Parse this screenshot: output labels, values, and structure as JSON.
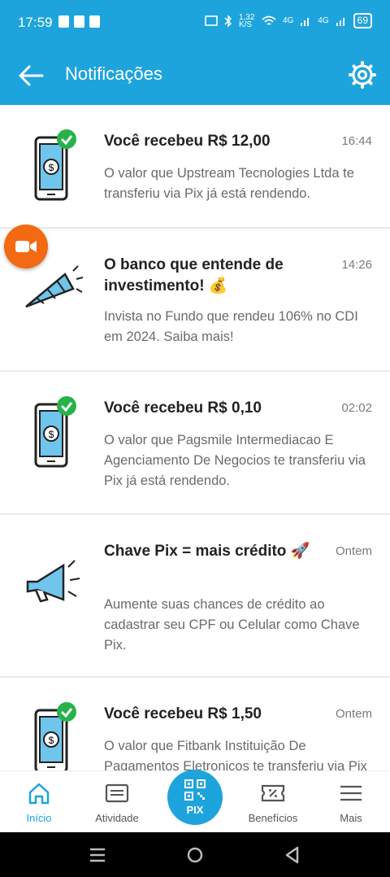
{
  "status_bar": {
    "time": "17:59",
    "net_speed": "1,32 K/S",
    "signal1": "4G",
    "signal2": "4G",
    "battery": "69"
  },
  "app_bar": {
    "title": "Notificações",
    "back_icon": "arrow-left-icon",
    "settings_icon": "gear-icon"
  },
  "notifications": [
    {
      "title": "Você recebeu R$ 12,00",
      "time": "16:44",
      "body": "O valor que Upstream Tecnologies Ltda te transferiu via Pix já está rendendo.",
      "icon": "phone-money-check-icon"
    },
    {
      "title": "O banco que entende de investimento! 💰",
      "time": "14:26",
      "body": "Invista no Fundo que rendeu 106% no CDI em 2024. Saiba mais!",
      "icon": "party-horn-icon"
    },
    {
      "title": "Você recebeu R$ 0,10",
      "time": "02:02",
      "body": "O valor que Pagsmile Intermediacao E Agenciamento De Negocios te transferiu via Pix já está rendendo.",
      "icon": "phone-money-check-icon"
    },
    {
      "title": "Chave Pix = mais crédito 🚀",
      "time": "Ontem",
      "body": "Aumente suas chances de crédito ao cadastrar seu CPF ou Celular como Chave Pix.",
      "icon": "megaphone-icon"
    },
    {
      "title": "Você recebeu R$ 1,50",
      "time": "Ontem",
      "body": "O valor que Fitbank Instituição De Pagamentos Eletronicos te transferiu via Pix já está rendendo.",
      "icon": "phone-money-check-icon"
    }
  ],
  "bottom_nav": {
    "inicio": "Início",
    "atividade": "Atividade",
    "pix": "PIX",
    "beneficios": "Benefícios",
    "mais": "Mais"
  },
  "colors": {
    "primary": "#1ea4dc",
    "fab": "#f36a12",
    "check": "#27b34a"
  }
}
